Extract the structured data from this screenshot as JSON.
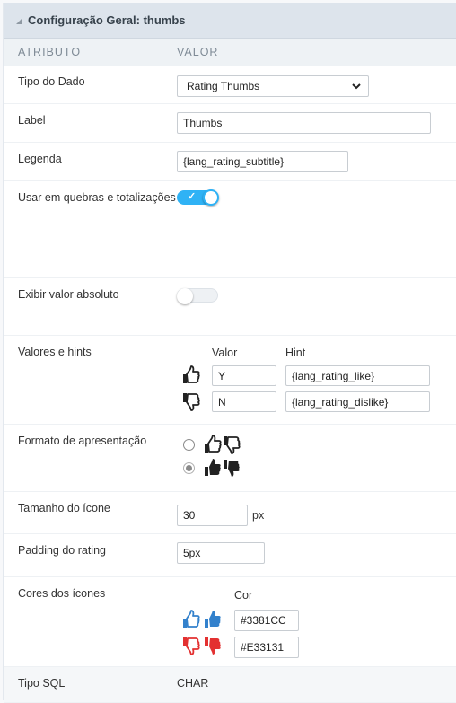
{
  "header": {
    "title": "Configuração Geral: thumbs"
  },
  "columns": {
    "attribute": "ATRIBUTO",
    "value": "VALOR"
  },
  "fields": {
    "data_type": {
      "label": "Tipo do Dado",
      "selected": "Rating Thumbs"
    },
    "label": {
      "label": "Label",
      "value": "Thumbs"
    },
    "subtitle": {
      "label": "Legenda",
      "value": "{lang_rating_subtitle}"
    },
    "use_in_breaks": {
      "label": "Usar em quebras e totalizações",
      "enabled": true,
      "check": "✓"
    },
    "show_absolute": {
      "label": "Exibir valor absoluto",
      "enabled": false
    },
    "values_hints": {
      "label": "Valores e hints",
      "col_value": "Valor",
      "col_hint": "Hint",
      "rows": [
        {
          "icon": "thumbs-up-outline-icon",
          "value": "Y",
          "hint": "{lang_rating_like}"
        },
        {
          "icon": "thumbs-down-outline-icon",
          "value": "N",
          "hint": "{lang_rating_dislike}"
        }
      ]
    },
    "display_format": {
      "label": "Formato de apresentação",
      "options": [
        {
          "style": "outline",
          "selected": false
        },
        {
          "style": "solid",
          "selected": true
        }
      ]
    },
    "icon_size": {
      "label": "Tamanho do ícone",
      "value": "30",
      "unit": "px"
    },
    "rating_padding": {
      "label": "Padding do rating",
      "value": "5px"
    },
    "icon_colors": {
      "label": "Cores dos ícones",
      "col_color": "Cor",
      "like_color": "#3381CC",
      "dislike_color": "#E33131"
    },
    "sql_type": {
      "label": "Tipo SQL",
      "value": "CHAR"
    }
  }
}
